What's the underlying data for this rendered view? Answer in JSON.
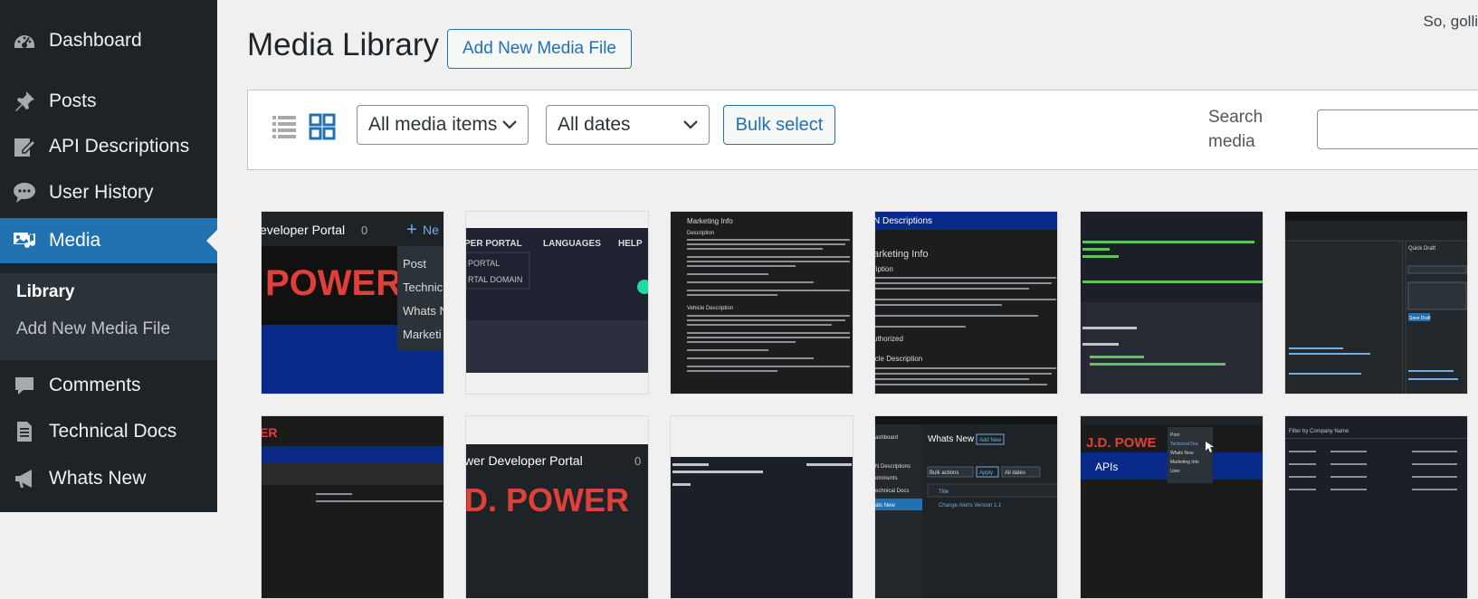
{
  "sidebar": {
    "items": [
      {
        "label": "Dashboard",
        "icon": "dashboard-icon"
      },
      {
        "label": "Posts",
        "icon": "pin-icon"
      },
      {
        "label": "API Descriptions",
        "icon": "edit-page-icon"
      },
      {
        "label": "User History",
        "icon": "comment-bubble-icon"
      },
      {
        "label": "Media",
        "icon": "media-icon"
      },
      {
        "label": "Comments",
        "icon": "comment-icon"
      },
      {
        "label": "Technical Docs",
        "icon": "document-icon"
      },
      {
        "label": "Whats New",
        "icon": "megaphone-icon"
      }
    ],
    "submenu": [
      {
        "label": "Library"
      },
      {
        "label": "Add New Media File"
      }
    ]
  },
  "header": {
    "howdy": "So, golli",
    "title": "Media Library",
    "add_new": "Add New Media File"
  },
  "toolbar": {
    "filter_type": "All media items",
    "filter_date": "All dates",
    "bulk_select": "Bulk select",
    "search_label": "Search media",
    "search_value": ""
  },
  "thumbnails": {
    "t1": {
      "brand": "POWER",
      "brand_prefix": "eveloper Portal",
      "new_label": "Ne",
      "menu": [
        "Post",
        "Technic",
        "Whats N",
        "Marketi"
      ]
    },
    "t2": {
      "nav": [
        "PER PORTAL",
        "LANGUAGES",
        "HELP"
      ],
      "menu": [
        "PORTAL",
        "RTAL DOMAIN"
      ]
    },
    "t3": {
      "heading": "Marketing Info",
      "sub1": "Description",
      "sub2": "Vehicle Description"
    },
    "t4": {
      "banner": "N Descriptions",
      "heading": "arketing Info",
      "sub1": "ription",
      "sub2": "icle Description",
      "status": "uthorized"
    },
    "t6": {
      "label": "Quick Draft",
      "button": "Save Draft"
    },
    "t7": {
      "brand": "ER"
    },
    "t8": {
      "brand": "wer Developer Portal",
      "brand2": "D. POWER"
    },
    "t10": {
      "title": "Whats New",
      "button": "Add New",
      "bulk": "Bulk actions",
      "apply": "Apply",
      "dates": "All dates",
      "col": "Title",
      "row": "Change Alerts Version 1.1",
      "side": [
        "ashboard",
        "N Descriptions",
        "omments",
        "echnical Docs",
        "ats New"
      ]
    },
    "t11": {
      "brand": "J.D. POWE",
      "menu_title": "APIs",
      "menu": [
        "Post",
        "Technical Doc",
        "Whats New",
        "Marketing Info",
        "User"
      ]
    },
    "t12": {
      "label": "Filter by Company Name"
    }
  },
  "colors": {
    "sidebar_bg": "#1d2327",
    "accent": "#2271b1",
    "brand_red": "#e0403a"
  }
}
